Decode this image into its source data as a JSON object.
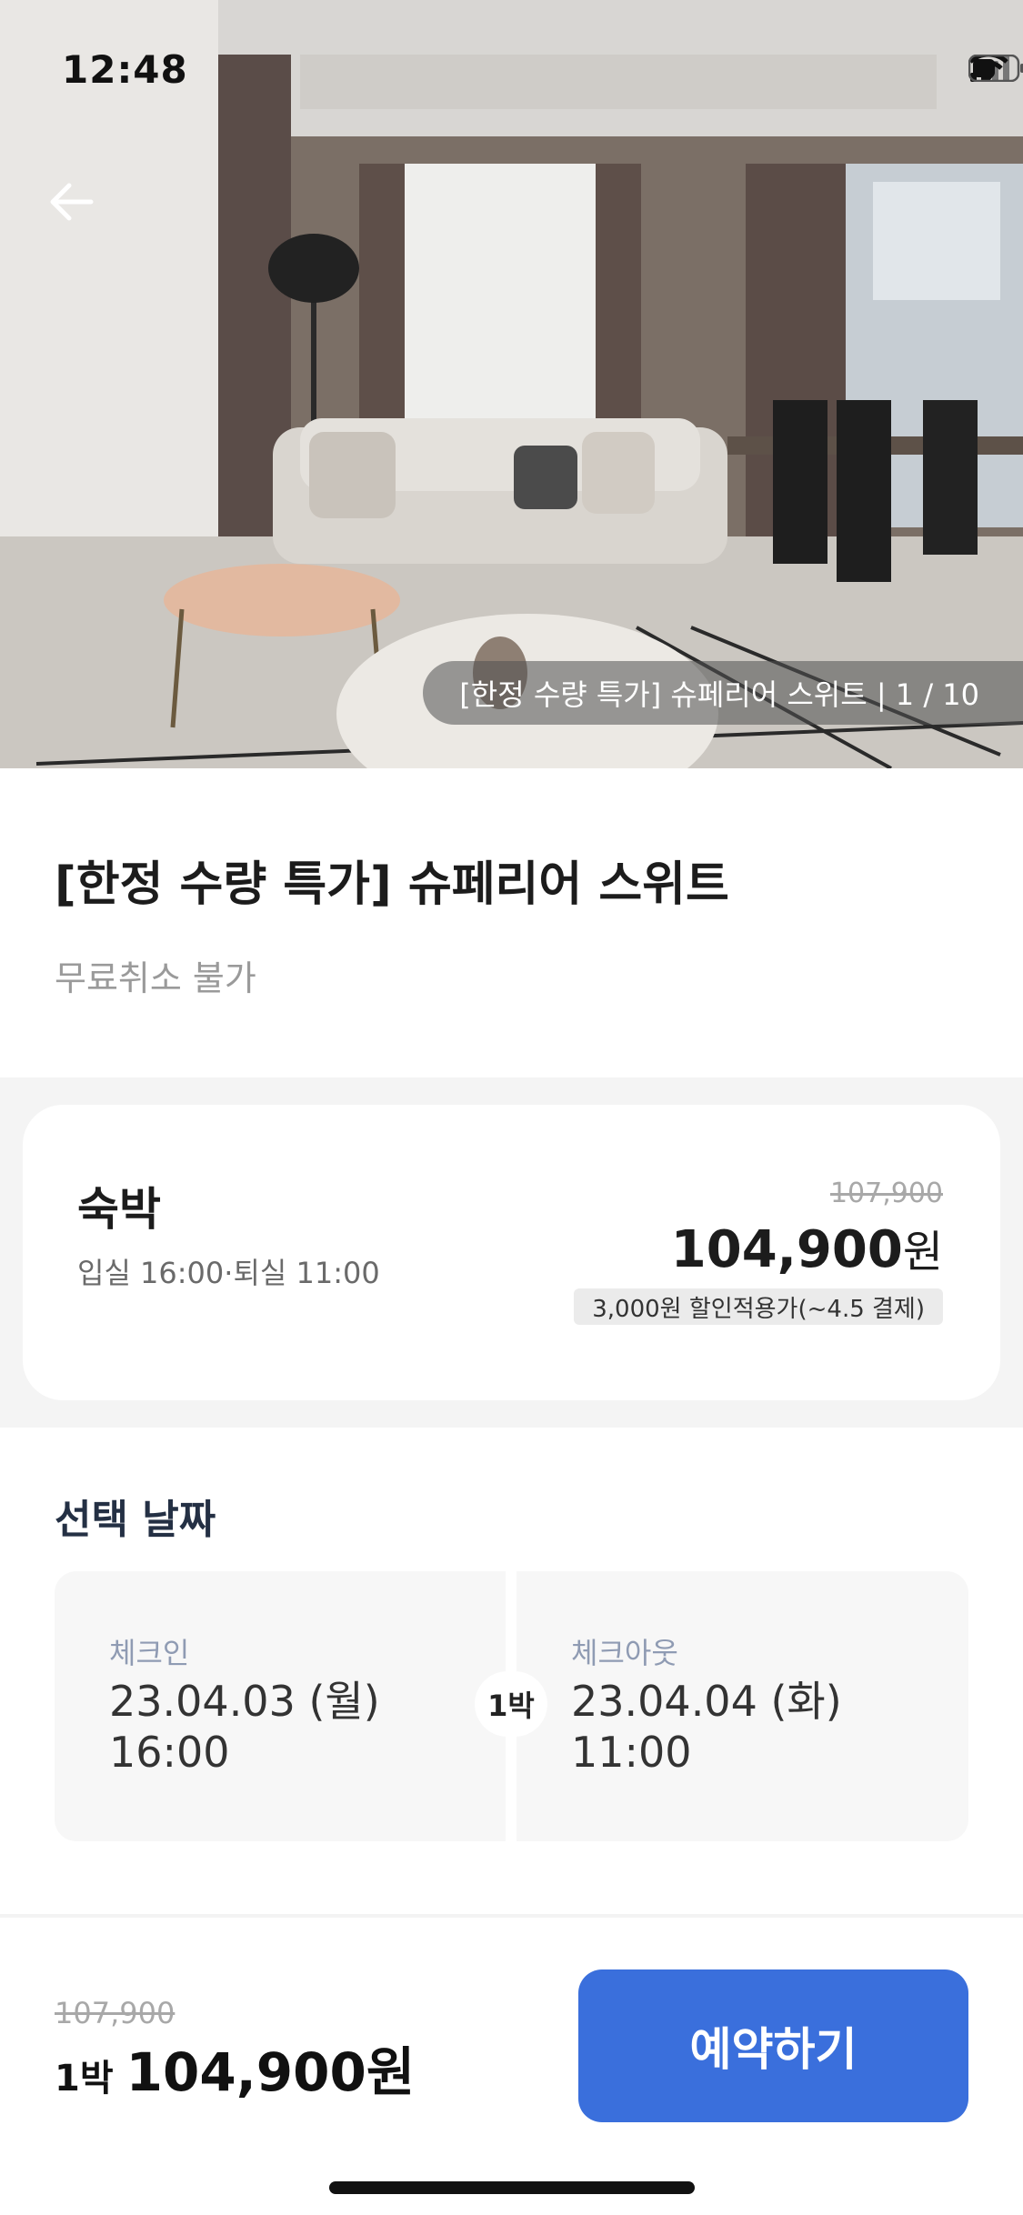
{
  "status_bar": {
    "time": "12:48"
  },
  "hero": {
    "caption": "[한정 수량 특가] 슈페리어 스위트 | 1 / 10",
    "back_icon": "arrow-left-icon"
  },
  "room": {
    "title": "[한정 수량 특가] 슈페리어 스위트",
    "cancel_policy": "무료취소 불가"
  },
  "stay_card": {
    "type": "숙박",
    "times": "입실 16:00·퇴실 11:00",
    "original_price": "107,900",
    "price": "104,900",
    "currency": "원",
    "promo": "3,000원 할인적용가(~4.5 결제)"
  },
  "dates": {
    "section_label": "선택 날짜",
    "checkin_label": "체크인",
    "checkin_date": "23.04.03 (월)",
    "checkin_time": "16:00",
    "nights": "1박",
    "checkout_label": "체크아웃",
    "checkout_date": "23.04.04 (화)",
    "checkout_time": "11:00"
  },
  "bottom_bar": {
    "original_price": "107,900",
    "nights": "1박",
    "price": "104,900원",
    "book_label": "예약하기"
  },
  "colors": {
    "accent": "#3a6fdc",
    "band": "#f4f4f4"
  }
}
